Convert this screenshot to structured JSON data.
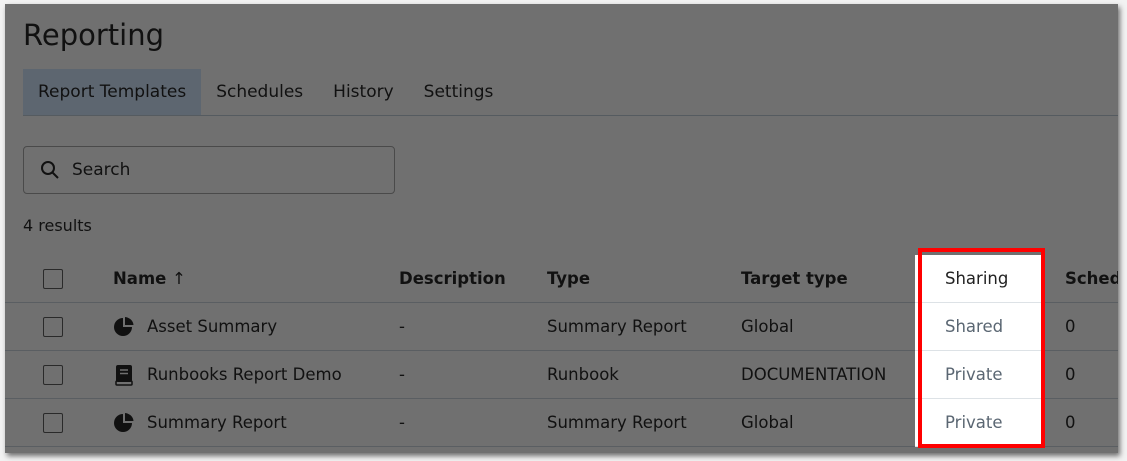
{
  "page": {
    "title": "Reporting"
  },
  "tabs": [
    {
      "label": "Report Templates",
      "active": true
    },
    {
      "label": "Schedules"
    },
    {
      "label": "History"
    },
    {
      "label": "Settings"
    }
  ],
  "search": {
    "placeholder": "Search",
    "icon": "search-icon"
  },
  "results_count": "4 results",
  "table": {
    "columns": {
      "name": "Name",
      "sort": "↑",
      "description": "Description",
      "type": "Type",
      "target": "Target type",
      "sharing": "Sharing",
      "sched": "Sched"
    },
    "rows": [
      {
        "icon": "pie-chart-icon",
        "name": "Asset Summary",
        "description": "-",
        "type": "Summary Report",
        "target": "Global",
        "sharing": "Shared",
        "sched": "0"
      },
      {
        "icon": "book-icon",
        "name": "Runbooks Report Demo",
        "description": "-",
        "type": "Runbook",
        "target": "DOCUMENTATION",
        "sharing": "Private",
        "sched": "0"
      },
      {
        "icon": "pie-chart-icon",
        "name": "Summary Report",
        "description": "-",
        "type": "Summary Report",
        "target": "Global",
        "sharing": "Private",
        "sched": "0"
      }
    ]
  },
  "colors": {
    "highlight_border": "#ff0000",
    "overlay": "#707070",
    "active_tab": "#5d6670"
  }
}
